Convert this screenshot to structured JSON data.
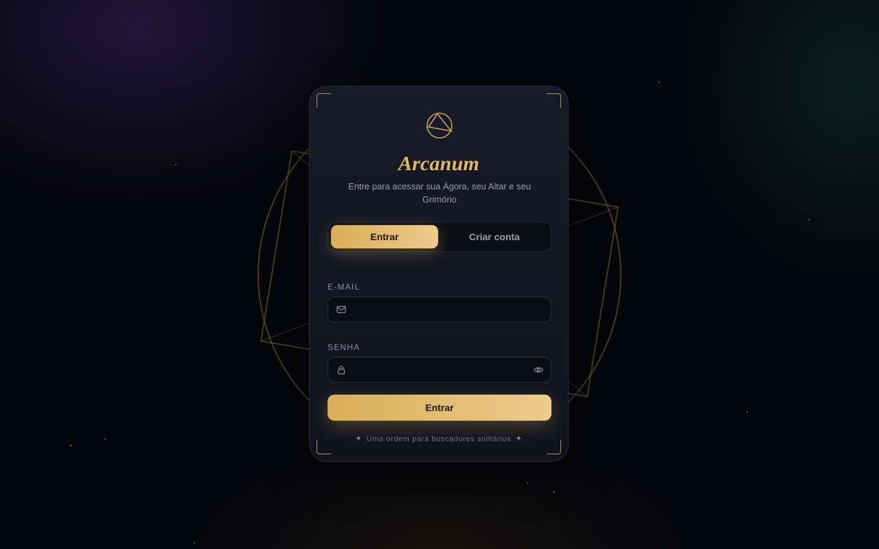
{
  "brand": {
    "name": "Arcanum",
    "subtitle": "Entre para acessar sua Ágora, seu Altar e seu Grimório",
    "logo_icon": "triangle-in-circle-icon",
    "accent_color": "#e2b865"
  },
  "tabs": [
    {
      "label": "Entrar",
      "active": true
    },
    {
      "label": "Criar conta",
      "active": false
    }
  ],
  "form": {
    "email": {
      "label": "E-MAIL",
      "value": "",
      "placeholder": "",
      "icon": "mail-icon"
    },
    "password": {
      "label": "SENHA",
      "value": "",
      "placeholder": "",
      "icon": "lock-icon",
      "toggle_icon": "eye-icon"
    },
    "submit_label": "Entrar"
  },
  "footer": {
    "text": "Uma ordem para buscadores solitários",
    "ornament": "✦"
  }
}
